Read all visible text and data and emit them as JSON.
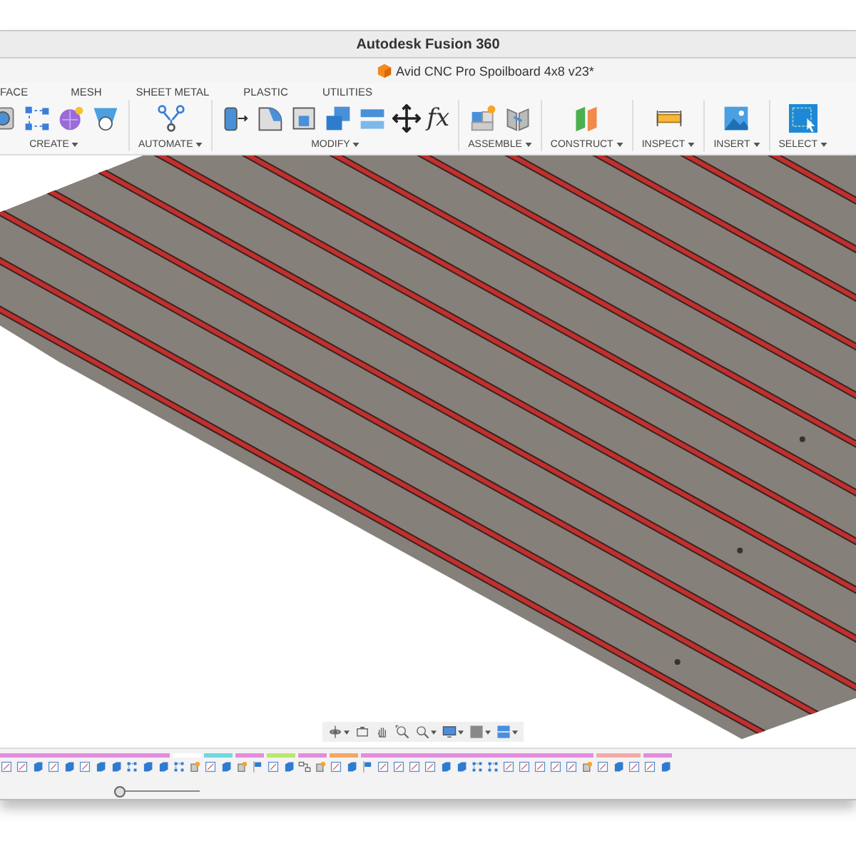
{
  "window": {
    "title": "Autodesk Fusion 360"
  },
  "document_tab": {
    "title": "Avid CNC Pro Spoilboard 4x8 v23*"
  },
  "toolbar_tabs": [
    {
      "label": "FACE"
    },
    {
      "label": "MESH"
    },
    {
      "label": "SHEET METAL"
    },
    {
      "label": "PLASTIC"
    },
    {
      "label": "UTILITIES"
    }
  ],
  "toolbar_groups": [
    {
      "label": "CREATE",
      "icons": [
        {
          "kind": "hole"
        },
        {
          "kind": "points"
        },
        {
          "kind": "form"
        },
        {
          "kind": "shell"
        }
      ]
    },
    {
      "label": "AUTOMATE",
      "icons": [
        {
          "kind": "branch"
        }
      ]
    },
    {
      "label": "MODIFY",
      "icons": [
        {
          "kind": "pressPull"
        },
        {
          "kind": "fillet"
        },
        {
          "kind": "shellBox"
        },
        {
          "kind": "combine"
        },
        {
          "kind": "plates"
        },
        {
          "kind": "move"
        },
        {
          "kind": "fx",
          "text": "fx"
        }
      ]
    },
    {
      "label": "ASSEMBLE",
      "icons": [
        {
          "kind": "newComponent"
        },
        {
          "kind": "joint"
        }
      ]
    },
    {
      "label": "CONSTRUCT",
      "icons": [
        {
          "kind": "planes"
        }
      ]
    },
    {
      "label": "INSPECT",
      "icons": [
        {
          "kind": "measure"
        }
      ]
    },
    {
      "label": "INSERT",
      "icons": [
        {
          "kind": "image"
        }
      ]
    },
    {
      "label": "SELECT",
      "icons": [
        {
          "kind": "select"
        }
      ]
    }
  ],
  "navigation_bar": [
    {
      "kind": "orbit"
    },
    {
      "kind": "look"
    },
    {
      "kind": "pan"
    },
    {
      "kind": "zoomWindow"
    },
    {
      "kind": "zoom"
    },
    {
      "kind": "display"
    },
    {
      "kind": "visual"
    },
    {
      "kind": "grid"
    }
  ],
  "timeline": [
    {
      "color": "#e58ce0",
      "items": [
        {
          "kind": "sketch"
        },
        {
          "kind": "sketch"
        },
        {
          "kind": "body"
        },
        {
          "kind": "sketch"
        },
        {
          "kind": "body"
        },
        {
          "kind": "sketch"
        },
        {
          "kind": "body"
        },
        {
          "kind": "body"
        },
        {
          "kind": "pattern"
        },
        {
          "kind": "body"
        },
        {
          "kind": "body"
        }
      ]
    },
    {
      "color": "#ffffff",
      "items": [
        {
          "kind": "pattern"
        },
        {
          "kind": "component"
        }
      ]
    },
    {
      "color": "#6fd8e0",
      "items": [
        {
          "kind": "sketch"
        },
        {
          "kind": "body"
        }
      ]
    },
    {
      "color": "#e58ce0",
      "items": [
        {
          "kind": "component"
        },
        {
          "kind": "flag"
        }
      ]
    },
    {
      "color": "#b9e86a",
      "items": [
        {
          "kind": "sketch"
        },
        {
          "kind": "body"
        }
      ]
    },
    {
      "color": "#e58ce0",
      "items": [
        {
          "kind": "link"
        },
        {
          "kind": "component"
        }
      ]
    },
    {
      "color": "#f4a860",
      "items": [
        {
          "kind": "sketch"
        },
        {
          "kind": "body"
        }
      ]
    },
    {
      "color": "#e58ce0",
      "items": [
        {
          "kind": "flag"
        },
        {
          "kind": "sketch"
        },
        {
          "kind": "sketch"
        },
        {
          "kind": "sketch"
        },
        {
          "kind": "sketch"
        },
        {
          "kind": "body"
        },
        {
          "kind": "body"
        },
        {
          "kind": "pattern"
        },
        {
          "kind": "pattern"
        },
        {
          "kind": "sketch"
        },
        {
          "kind": "sketch"
        },
        {
          "kind": "sketch"
        },
        {
          "kind": "sketch"
        },
        {
          "kind": "sketch"
        },
        {
          "kind": "component"
        }
      ]
    },
    {
      "color": "#f5aaa8",
      "items": [
        {
          "kind": "sketch"
        },
        {
          "kind": "body"
        },
        {
          "kind": "sketch"
        }
      ]
    },
    {
      "color": "#e58ce0",
      "items": [
        {
          "kind": "sketch"
        },
        {
          "kind": "body"
        }
      ]
    }
  ],
  "timeline_position": {
    "level": 0
  }
}
